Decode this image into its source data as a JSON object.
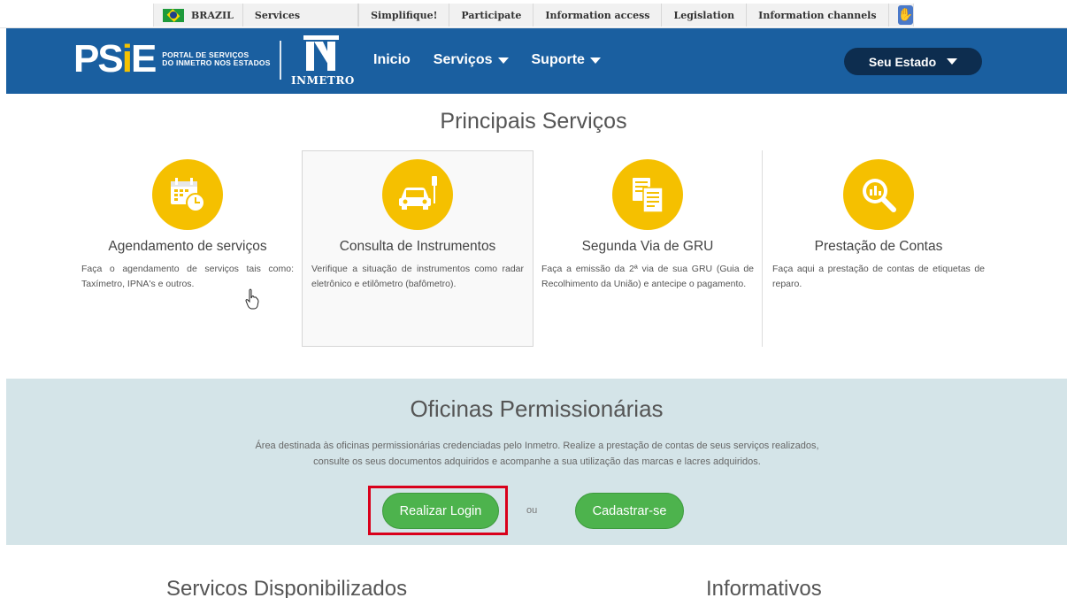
{
  "gov_bar": {
    "country": "BRAZIL",
    "links": [
      "Services",
      "Simplifique!",
      "Participate",
      "Information access",
      "Legislation",
      "Information channels"
    ]
  },
  "header": {
    "logo_text": "PSIE",
    "logo_subtitle_line1": "PORTAL DE SERVIÇOS",
    "logo_subtitle_line2": "DO INMETRO NOS ESTADOS",
    "partner_logo": "INMETRO",
    "nav": [
      {
        "label": "Inicio",
        "has_dropdown": false
      },
      {
        "label": "Serviços",
        "has_dropdown": true
      },
      {
        "label": "Suporte",
        "has_dropdown": true
      }
    ],
    "state_button": "Seu Estado",
    "bg_color": "#1a5fa0"
  },
  "principais": {
    "title": "Principais Serviços",
    "services": [
      {
        "title": "Agendamento de serviços",
        "description": "Faça o agendamento de serviços tais como: Taxímetro, IPNA's e outros.",
        "icon": "calendar-clock-icon"
      },
      {
        "title": "Consulta de Instrumentos",
        "description": "Verifique a situação de instrumentos como radar eletrônico e etilômetro (bafômetro).",
        "icon": "car-radar-icon"
      },
      {
        "title": "Segunda Via de GRU",
        "description": "Faça a emissão da 2ª via de sua GRU (Guia de Recolhimento da União) e antecipe o pagamento.",
        "icon": "documents-icon"
      },
      {
        "title": "Prestação de Contas",
        "description": "Faça aqui a prestação de contas de etiquetas de reparo.",
        "icon": "chart-magnifier-icon"
      }
    ],
    "icon_color": "#f5c000"
  },
  "oficinas": {
    "title": "Oficinas Permissionárias",
    "description_line1": "Área destinada às oficinas permissionárias credenciadas pelo Inmetro. Realize a prestação de contas de seus serviços realizados,",
    "description_line2": "consulte os seus documentos adquiridos e acompanhe a sua utilização das marcas e lacres adquiridos.",
    "login_button": "Realizar Login",
    "separator": "ou",
    "register_button": "Cadastrar-se",
    "bg_color": "#d4e4e8",
    "button_color": "#4db34d",
    "highlight_color": "#d9001b"
  },
  "bottom": {
    "left_title": "Servicos Disponibilizados",
    "right_title": "Informativos"
  }
}
